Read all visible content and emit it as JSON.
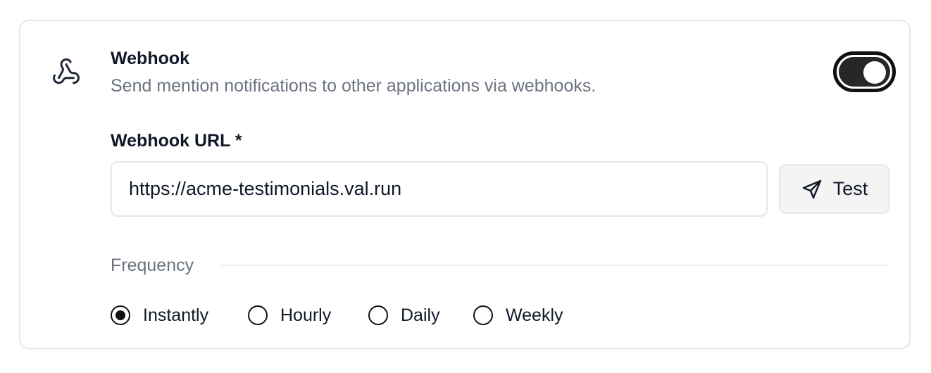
{
  "webhook": {
    "icon": "webhook-icon",
    "title": "Webhook",
    "description": "Send mention notifications to other applications via webhooks.",
    "enabled": true
  },
  "url_field": {
    "label": "Webhook URL *",
    "value": "https://acme-testimonials.val.run",
    "test_button": {
      "icon": "send-icon",
      "label": "Test"
    }
  },
  "frequency": {
    "label": "Frequency",
    "selected": "Instantly",
    "options": [
      {
        "label": "Instantly"
      },
      {
        "label": "Hourly"
      },
      {
        "label": "Daily"
      },
      {
        "label": "Weekly"
      }
    ]
  },
  "colors": {
    "text_primary": "#111827",
    "text_secondary": "#6b7280",
    "border": "#e5e7eb",
    "toggle_on": "#27272a"
  }
}
